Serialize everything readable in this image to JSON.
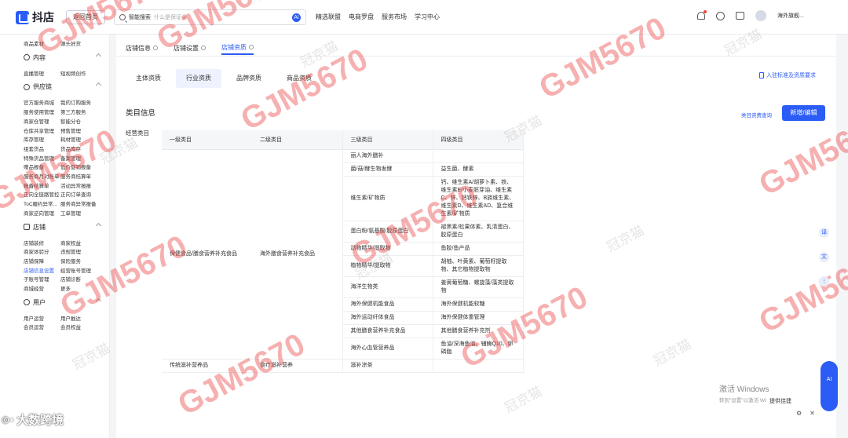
{
  "topbar": {
    "app_name": "抖店",
    "home_button": "返回首页",
    "search_label": "智能搜索",
    "search_placeholder": "什么是保证金",
    "ai_badge": "AI",
    "nav": [
      "精选联盟",
      "电商罗盘",
      "服务市场",
      "学习中心"
    ],
    "username": "海外旗舰..."
  },
  "sidebar": {
    "top_rows": [
      [
        "商品素材",
        "源头好货"
      ]
    ],
    "content_section": {
      "title": "内容",
      "rows": [
        [
          "直播管理",
          "短视频创作"
        ]
      ]
    },
    "supply_section": {
      "title": "供应链",
      "rows": [
        [
          "官方服务商城",
          "我的订购服务"
        ],
        [
          "服务使用管理",
          "第三方服务"
        ],
        [
          "商家仓管理",
          "智能分仓"
        ],
        [
          "仓库共享管理",
          "预售管理"
        ],
        [
          "库存管理",
          "耗材管理"
        ],
        [
          "组套货品",
          "货品库存"
        ],
        [
          "特殊货品管理",
          "备案管理"
        ],
        [
          "赠品报备",
          "低价促销报备"
        ],
        [
          "服务商月对账单",
          "服务商结算单"
        ],
        [
          "报备结算单",
          "活动异常报报"
        ],
        [
          "正向全链路管控",
          "正向订单查询"
        ],
        [
          "ToC履约异常...",
          "服务商异常报备"
        ],
        [
          "商家逆向管理",
          "工单管理"
        ]
      ]
    },
    "store_section": {
      "title": "店铺",
      "rows": [
        [
          "店铺装修",
          "商家权益"
        ],
        [
          "商家体验分",
          "违规管理"
        ],
        [
          "店铺保障",
          "保险服务"
        ],
        [
          "店铺信息设置",
          "经营账号管理"
        ],
        [
          "子账号管理",
          "店铺诊断"
        ],
        [
          "商城经营",
          "更多"
        ]
      ],
      "active": "店铺信息设置"
    },
    "user_section": {
      "title": "用户",
      "rows": [
        [
          "用户运营",
          "用户触达"
        ],
        [
          "会员运营",
          "会员权益"
        ]
      ]
    },
    "brand_text": "大数跨境"
  },
  "main": {
    "tabs": [
      {
        "label": "店铺信息",
        "active": false
      },
      {
        "label": "店铺设置",
        "active": false
      },
      {
        "label": "店铺资质",
        "active": true
      }
    ],
    "subtabs": [
      {
        "label": "主体资质",
        "active": false
      },
      {
        "label": "行业资质",
        "active": true
      },
      {
        "label": "品牌资质",
        "active": false
      },
      {
        "label": "商品资质",
        "active": false
      }
    ],
    "entry_link": "入驻标准及资质要求",
    "section_title": "类目信息",
    "query_link": "类目资费查询",
    "add_button": "新增/编辑",
    "biz_label": "经营类目",
    "table": {
      "headers": [
        "一级类目",
        "二级类目",
        "三级类目",
        "四级类目"
      ],
      "level1": "保健食品/膳食营养补充食品",
      "level2": "海外膳食营养补充食品",
      "rows": [
        {
          "l3": "丽人海外膳补",
          "l4": ""
        },
        {
          "l3": "菌/菇/酵生物发酵",
          "l4": "益生菌、酵素"
        },
        {
          "l3": "维生素/矿物质",
          "l4": "钙、维生素A/胡萝卜素、铁、维生素E/小麦胚芽油、维生素C、锌、钙铁锌、B族维生素、维生素D、维生素AD、复合维生素/矿物质"
        },
        {
          "l3": "蛋白粉/氨基酸/胶原蛋白",
          "l4": "褪黑素/松果体素、乳清蛋白、胶原蛋白"
        },
        {
          "l3": "动物精华/提取物",
          "l4": "鱼胶/鱼产品"
        },
        {
          "l3": "植物精华/提取物",
          "l4": "胡柚、叶黄素、葡萄籽提取物、其它植物提取物"
        },
        {
          "l3": "海洋生物类",
          "l4": "姜黄葡萄糖、螺旋藻/藻类提取物"
        },
        {
          "l3": "海外保健机能食品",
          "l4": "海外保健机能软糖"
        },
        {
          "l3": "海外运动纤体食品",
          "l4": "海外保健体重管理"
        },
        {
          "l3": "其他膳食营养补充食品",
          "l4": "其他膳食营养补充剂"
        },
        {
          "l3": "海外心血管营养品",
          "l4": "鱼油/深海鱼油、辅酶Q10、卵磷脂"
        }
      ],
      "last_row": {
        "l1": "传统滋补营养品",
        "l2": "食疗滋补营养",
        "l3": "滋补凉茶",
        "l4": ""
      }
    }
  },
  "overlay": {
    "watermark_text": "GJM5670",
    "watermark_cn": "冠京猫",
    "windows_activation": "激活 Windows",
    "windows_activation_sub": "转到\"设置\"以激活 Windows。",
    "feedback": "提供佳建",
    "ai_label": "AI"
  },
  "colors": {
    "accent": "#2c5cf6",
    "watermark": "#eb5050"
  }
}
